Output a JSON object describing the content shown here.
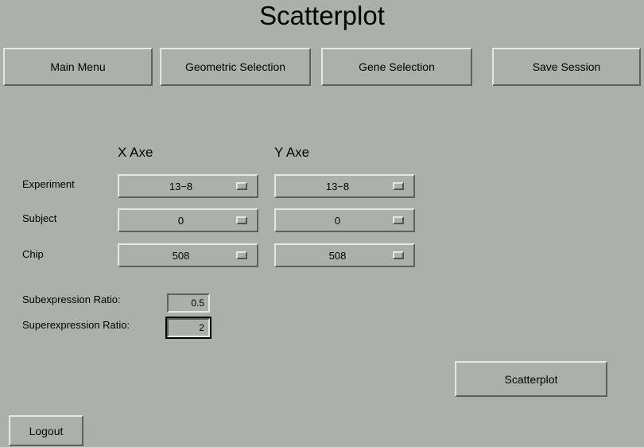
{
  "window": {
    "title": "Scatterplot",
    "background_color": "#a9b1a9",
    "bevel_light_color": "#e2e8e2",
    "bevel_dark_color": "#5b645b",
    "text_color": "#000000"
  },
  "toolbar": {
    "buttons": [
      {
        "label": "Main Menu",
        "name": "main-menu-button"
      },
      {
        "label": "Geometric Selection",
        "name": "geometric-selection-button"
      },
      {
        "label": "Gene Selection",
        "name": "gene-selection-button"
      },
      {
        "label": "Save Session",
        "name": "save-session-button"
      }
    ]
  },
  "form": {
    "column_headings": {
      "x": "X Axe",
      "y": "Y Axe"
    },
    "rows": [
      {
        "label": "Experiment",
        "x_value": "13−8",
        "y_value": "13−8"
      },
      {
        "label": "Subject",
        "x_value": "0",
        "y_value": "0"
      },
      {
        "label": "Chip",
        "x_value": "508",
        "y_value": "508"
      }
    ],
    "ratios": [
      {
        "label": "Subexpression Ratio:",
        "value": "0.5",
        "placeholder": "0.5",
        "focused": false
      },
      {
        "label": "Superexpression Ratio:",
        "value": "2",
        "placeholder": "2",
        "focused": true
      }
    ]
  },
  "actions": {
    "scatterplot_label": "Scatterplot",
    "logout_label": "Logout"
  },
  "icons": {
    "dropdown_indicator": "option-menu-indicator"
  }
}
